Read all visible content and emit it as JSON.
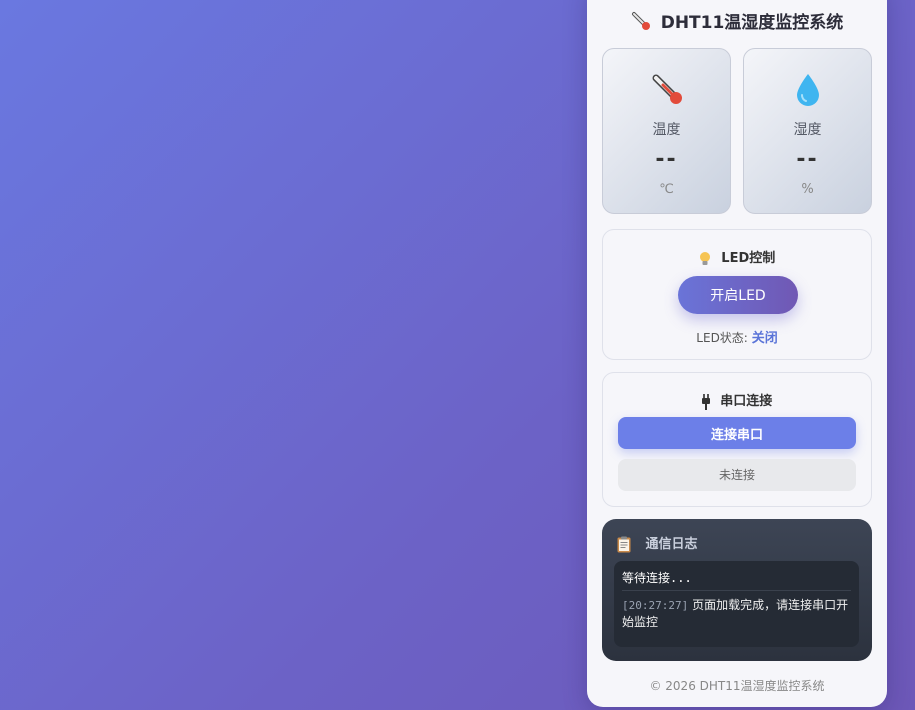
{
  "app": {
    "title": "DHT11温湿度监控系统",
    "title_icon": "thermometer-icon"
  },
  "sensors": {
    "temperature": {
      "icon": "thermometer-icon",
      "label": "温度",
      "value": "--",
      "unit": "℃"
    },
    "humidity": {
      "icon": "droplet-icon",
      "label": "湿度",
      "value": "--",
      "unit": "%"
    }
  },
  "led": {
    "icon": "lightbulb-icon",
    "heading": "LED控制",
    "button_label": "开启LED",
    "status_label": "LED状态:",
    "status_value": "关闭"
  },
  "serial": {
    "icon": "plug-icon",
    "heading": "串口连接",
    "connect_label": "连接串口",
    "status": "未连接"
  },
  "log": {
    "icon": "clipboard-icon",
    "heading": "通信日志",
    "line1_text": "等待连接",
    "line1_dots": "...",
    "entry_time": "[20:27:27]",
    "entry_text": "页面加载完成，请连接串口开始监控"
  },
  "footer": {
    "text": "© 2026 DHT11温湿度监控系统"
  },
  "colors": {
    "background_start": "#6a78e0",
    "background_end": "#6d58b8",
    "accent": "#6c7fe8",
    "status_accent": "#5a74d8",
    "log_background": "#2c323e"
  }
}
